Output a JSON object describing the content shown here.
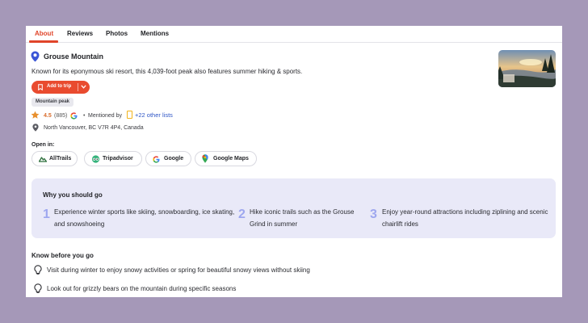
{
  "tabs": [
    {
      "label": "About",
      "active": true
    },
    {
      "label": "Reviews",
      "active": false
    },
    {
      "label": "Photos",
      "active": false
    },
    {
      "label": "Mentions",
      "active": false
    }
  ],
  "place": {
    "name": "Grouse Mountain",
    "description": "Known for its eponymous ski resort, this 4,039-foot peak also features summer hiking & sports.",
    "add_to_trip_label": "Add to trip",
    "tag": "Mountain peak",
    "rating": "4.5",
    "review_count": "(885)",
    "mentioned_by": "Mentioned by",
    "other_lists": "+22 other lists",
    "address": "North Vancouver, BC V7R 4P4, Canada"
  },
  "open_in": {
    "label": "Open in:",
    "apps": [
      "AllTrails",
      "Tripadvisor",
      "Google",
      "Google Maps"
    ]
  },
  "why": {
    "title": "Why you should go",
    "items": [
      {
        "num": "1",
        "text": "Experience winter sports like skiing, snowboarding, ice skating, and snowshoeing"
      },
      {
        "num": "2",
        "text": "Hike iconic trails such as the Grouse Grind in summer"
      },
      {
        "num": "3",
        "text": "Enjoy year-round attractions including ziplining and scenic chairlift rides"
      }
    ]
  },
  "know": {
    "title": "Know before you go",
    "tips": [
      "Visit during winter to enjoy snowy activities or spring for beautiful snowy views without skiing",
      "Look out for grizzly bears on the mountain during specific seasons"
    ]
  },
  "colors": {
    "accent": "#e94b2f",
    "link": "#2f56c6",
    "panel": "#e9e9f8",
    "number": "#9ea7ef"
  }
}
